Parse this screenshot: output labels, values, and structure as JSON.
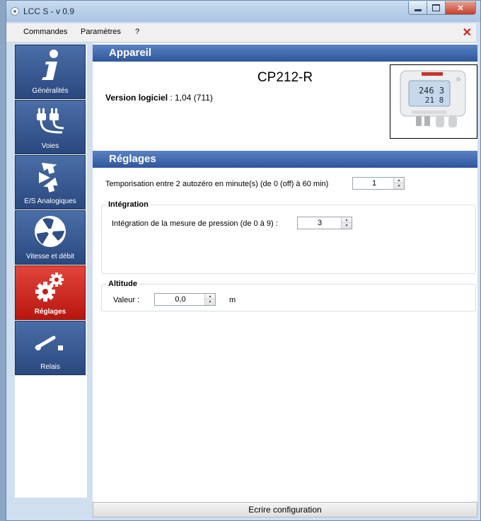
{
  "window": {
    "title": "LCC S - v 0.9"
  },
  "menu": {
    "items": [
      "Commandes",
      "Paramètres",
      "?"
    ]
  },
  "sidebar": {
    "items": [
      {
        "label": "Généralités",
        "icon": "info-icon"
      },
      {
        "label": "Voies",
        "icon": "plugs-icon"
      },
      {
        "label": "E/S Analogiques",
        "icon": "io-arrows-icon"
      },
      {
        "label": "Vitesse et débit",
        "icon": "fan-icon"
      },
      {
        "label": "Réglages",
        "icon": "gears-icon",
        "active": true
      },
      {
        "label": "Relais",
        "icon": "relay-switch-icon"
      }
    ]
  },
  "appareil": {
    "header": "Appareil",
    "device_name": "CP212-R",
    "version_label": "Version logiciel",
    "version_value": "1,04 (711)",
    "display_line1": "246 3",
    "display_line2": "21 8"
  },
  "reglages": {
    "header": "Réglages",
    "autozero_label": "Temporisation entre 2 autozéro en minute(s) (de 0 (off) à 60 min)",
    "autozero_value": "1",
    "integration": {
      "title": "Intégration",
      "label": "Intégration de la mesure de pression (de 0 à 9) :",
      "value": "3"
    },
    "altitude": {
      "title": "Altitude",
      "label": "Valeur :",
      "value": "0,0",
      "unit": "m"
    }
  },
  "footer": {
    "write_button": "Ecrire configuration"
  },
  "colors": {
    "nav_blue": "#3a5c96",
    "nav_active_red": "#cc2a22",
    "header_blue": "#3e67ab"
  }
}
